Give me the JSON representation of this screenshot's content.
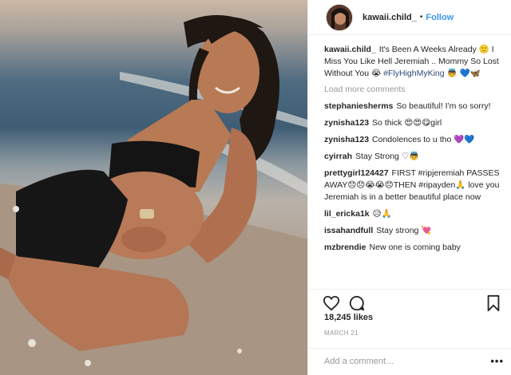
{
  "header": {
    "username": "kawaii.child_",
    "separator": "•",
    "follow_label": "Follow"
  },
  "caption": {
    "username": "kawaii.child_",
    "text": "It's Been A Weeks Already 🙁 I Miss You Like Hell Jeremiah .. Mommy So Lost Without You 😭 ",
    "hashtag": "#FlyHighMyKing",
    "trailing": " 👼 💙🦋"
  },
  "load_more": "Load more comments",
  "comments": [
    {
      "user": "stephaniesherms",
      "text": "So beautiful! I'm so sorry!"
    },
    {
      "user": "zynisha123",
      "text": "So thick 😍😍😋girl"
    },
    {
      "user": "zynisha123",
      "text": "Condolences to u tho 💜💙"
    },
    {
      "user": "cyirrah",
      "text": "Stay Strong ♡👼"
    },
    {
      "user": "prettygirl124427",
      "text": "FIRST #ripjeremiah PASSES AWAY😞😞😭😭😞THEN #ripayden🙏 love you Jeremiah is in a better beautiful place now"
    },
    {
      "user": "lil_ericka1k",
      "text": "😥🙏"
    },
    {
      "user": "issahandfull",
      "text": "Stay strong 💘"
    },
    {
      "user": "mzbrendie",
      "text": "New one is coming baby"
    }
  ],
  "likes": "18,245 likes",
  "date": "MARCH 21",
  "add_comment_placeholder": "Add a comment…",
  "more_label": "•••",
  "icons": [
    "heart-icon",
    "comment-icon",
    "bookmark-icon"
  ],
  "colors": {
    "link": "#3897f0",
    "hashtag": "#003569",
    "muted": "#999999",
    "text": "#262626"
  }
}
